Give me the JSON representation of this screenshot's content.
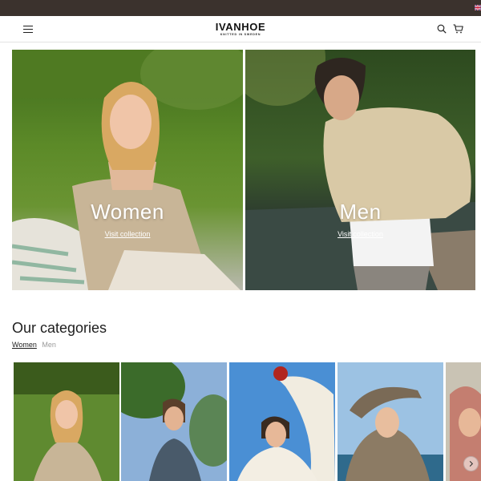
{
  "topbar": {
    "flag_icon": "uk-flag-icon"
  },
  "header": {
    "logo_main": "IVANHOE",
    "logo_sub": "KNITTED IN SWEDEN",
    "icons": [
      "menu-icon",
      "search-icon",
      "cart-icon"
    ]
  },
  "hero": [
    {
      "title": "Women",
      "link": "Visit collection"
    },
    {
      "title": "Men",
      "link": "Visit collection"
    }
  ],
  "categories": {
    "title": "Our categories",
    "tabs": [
      {
        "label": "Women",
        "active": true
      },
      {
        "label": "Men",
        "active": false
      }
    ]
  },
  "colors": {
    "topbar": "#3b322d",
    "text": "#1e1e1e",
    "muted": "#9a9a9a"
  }
}
